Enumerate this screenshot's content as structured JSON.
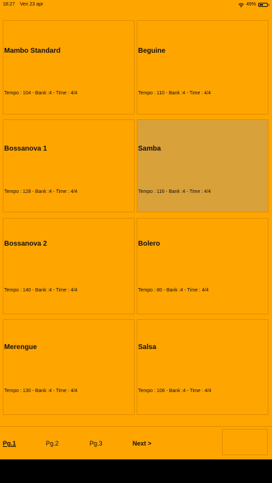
{
  "status_bar": {
    "time": "18:27",
    "date": "Ven 23 apr",
    "battery": "49%",
    "battery_level": 0.49
  },
  "rhythms": [
    {
      "name": "Mambo Standard",
      "info": "Tempo : 104 - Bank :4 - Time : 4/4",
      "selected": false
    },
    {
      "name": "Beguine",
      "info": "Tempo : 110 - Bank :4 - Time : 4/4",
      "selected": false
    },
    {
      "name": "Bossanova 1",
      "info": "Tempo : 128 - Bank :4 - Time : 4/4",
      "selected": false
    },
    {
      "name": "Samba",
      "info": "Tempo : 116 - Bank :4 - Time : 4/4",
      "selected": true
    },
    {
      "name": "Bossanova 2",
      "info": "Tempo : 140 - Bank :4 - Time : 4/4",
      "selected": false
    },
    {
      "name": "Bolero",
      "info": "Tempo : 80 - Bank :4 - Time : 4/4",
      "selected": false
    },
    {
      "name": "Merengue",
      "info": "Tempo : 130 - Bank :4 - Time : 4/4",
      "selected": false
    },
    {
      "name": "Salsa",
      "info": "Tempo : 106 - Bank :4 - Time : 4/4",
      "selected": false
    }
  ],
  "pager": {
    "pages": [
      "Pg.1",
      "Pg.2",
      "Pg.3"
    ],
    "current": 0,
    "next": "Next >"
  },
  "colors": {
    "background": "#FFA500",
    "selected": "#D9A13A",
    "border": "#E08F00"
  }
}
